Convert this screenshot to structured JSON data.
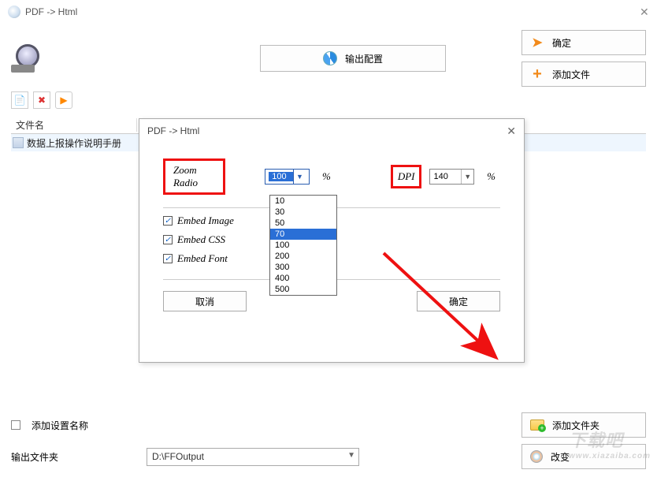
{
  "titlebar": {
    "title": "PDF -> Html"
  },
  "top": {
    "output_config": "输出配置",
    "ok": "确定",
    "add_file": "添加文件"
  },
  "table": {
    "headers": {
      "filename": "文件名"
    },
    "row0": {
      "name": "数据上报操作说明手册"
    }
  },
  "dialog": {
    "title": "PDF -> Html",
    "zoom_label": "Zoom Radio",
    "zoom_value": "100",
    "zoom_suffix": "%",
    "dpi_label": "DPI",
    "dpi_value": "140",
    "dpi_suffix": "%",
    "embed_image": "Embed Image",
    "embed_css": "Embed CSS",
    "embed_font": "Embed Font",
    "cancel": "取消",
    "ok": "确定",
    "dropdown_options": [
      "10",
      "30",
      "50",
      "70",
      "100",
      "200",
      "300",
      "400",
      "500"
    ],
    "dropdown_highlight": "70"
  },
  "bottom": {
    "add_preset_label": "添加设置名称",
    "output_folder_label": "输出文件夹",
    "output_folder_value": "D:\\FFOutput",
    "add_folder": "添加文件夹",
    "change": "改变"
  },
  "watermark": {
    "brand": "下载吧",
    "url": "www.xiazaiba.com"
  }
}
